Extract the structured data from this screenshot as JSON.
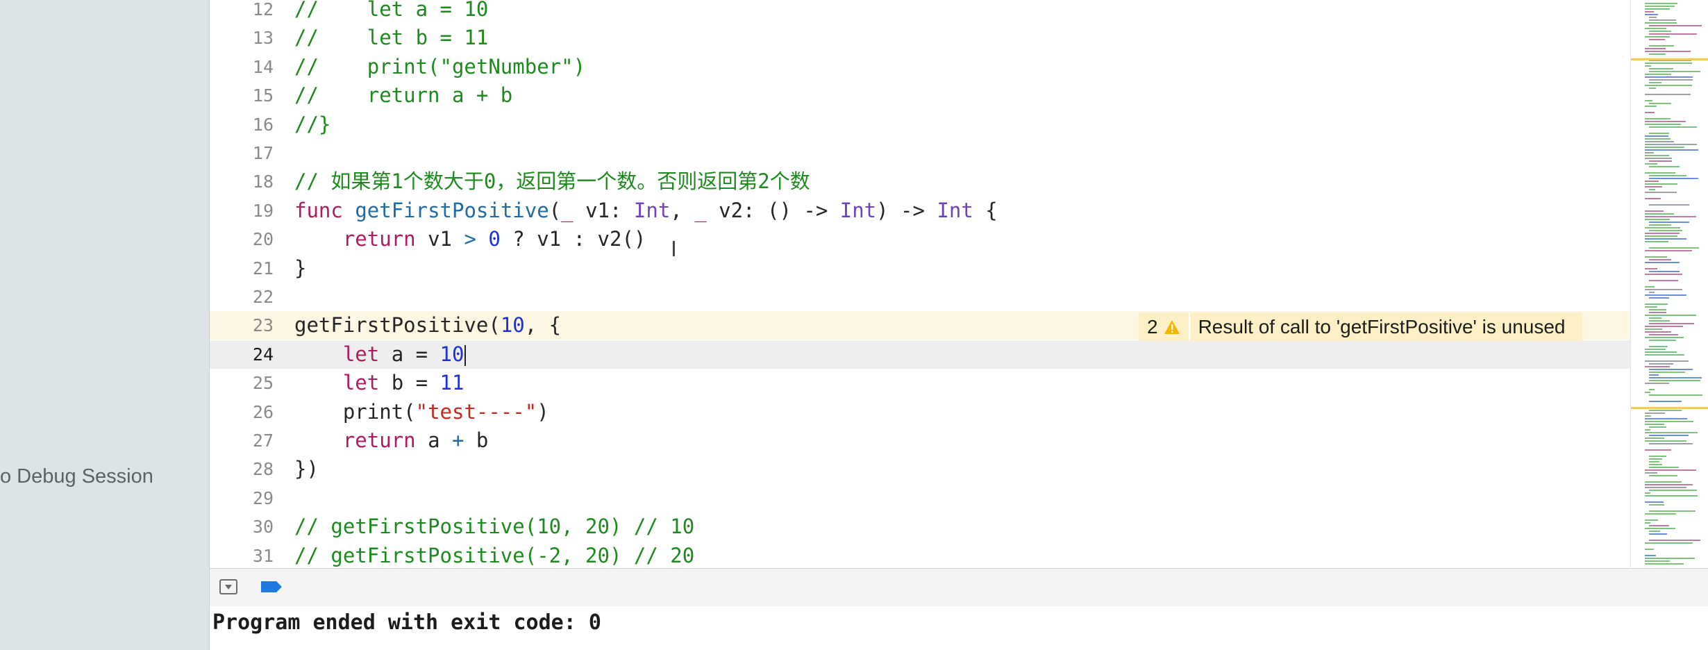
{
  "sidebar": {
    "debug_session_label": "o Debug Session"
  },
  "editor": {
    "lines": [
      {
        "num": "12",
        "tokens": [
          {
            "c": "c",
            "t": "//    let a = 10"
          }
        ]
      },
      {
        "num": "13",
        "tokens": [
          {
            "c": "c",
            "t": "//    let b = 11"
          }
        ]
      },
      {
        "num": "14",
        "tokens": [
          {
            "c": "c",
            "t": "//    print(\"getNumber\")"
          }
        ]
      },
      {
        "num": "15",
        "tokens": [
          {
            "c": "c",
            "t": "//    return a + b"
          }
        ]
      },
      {
        "num": "16",
        "tokens": [
          {
            "c": "c",
            "t": "//}"
          }
        ]
      },
      {
        "num": "17",
        "tokens": []
      },
      {
        "num": "18",
        "tokens": [
          {
            "c": "c",
            "t": "// 如果第1个数大于0，返回第一个数。否则返回第2个数"
          }
        ]
      },
      {
        "num": "19",
        "tokens": [
          {
            "c": "k",
            "t": "func "
          },
          {
            "c": "f",
            "t": "getFirstPositive"
          },
          {
            "c": "p",
            "t": "("
          },
          {
            "c": "k",
            "t": "_ "
          },
          {
            "c": "i",
            "t": "v1: "
          },
          {
            "c": "t",
            "t": "Int"
          },
          {
            "c": "p",
            "t": ", "
          },
          {
            "c": "k",
            "t": "_ "
          },
          {
            "c": "i",
            "t": "v2: () -> "
          },
          {
            "c": "t",
            "t": "Int"
          },
          {
            "c": "p",
            "t": ") -> "
          },
          {
            "c": "t",
            "t": "Int"
          },
          {
            "c": "p",
            "t": " {"
          }
        ]
      },
      {
        "num": "20",
        "tokens": [
          {
            "c": "p",
            "t": "    "
          },
          {
            "c": "k",
            "t": "return "
          },
          {
            "c": "i",
            "t": "v1 "
          },
          {
            "c": "f",
            "t": "> "
          },
          {
            "c": "n",
            "t": "0"
          },
          {
            "c": "p",
            "t": " ? v1 : v2()"
          }
        ]
      },
      {
        "num": "21",
        "tokens": [
          {
            "c": "p",
            "t": "}"
          }
        ]
      },
      {
        "num": "22",
        "tokens": []
      },
      {
        "num": "23",
        "highlight": "warning",
        "tokens": [
          {
            "c": "i",
            "t": "getFirstPositive("
          },
          {
            "c": "n",
            "t": "10"
          },
          {
            "c": "p",
            "t": ", {"
          }
        ]
      },
      {
        "num": "24",
        "highlight": "current",
        "cursor": true,
        "tokens": [
          {
            "c": "p",
            "t": "    "
          },
          {
            "c": "k",
            "t": "let "
          },
          {
            "c": "i",
            "t": "a = "
          },
          {
            "c": "n",
            "t": "10"
          }
        ]
      },
      {
        "num": "25",
        "tokens": [
          {
            "c": "p",
            "t": "    "
          },
          {
            "c": "k",
            "t": "let "
          },
          {
            "c": "i",
            "t": "b = "
          },
          {
            "c": "n",
            "t": "11"
          }
        ]
      },
      {
        "num": "26",
        "tokens": [
          {
            "c": "p",
            "t": "    "
          },
          {
            "c": "i",
            "t": "print("
          },
          {
            "c": "s",
            "t": "\"test----\""
          },
          {
            "c": "p",
            "t": ")"
          }
        ]
      },
      {
        "num": "27",
        "tokens": [
          {
            "c": "p",
            "t": "    "
          },
          {
            "c": "k",
            "t": "return "
          },
          {
            "c": "i",
            "t": "a "
          },
          {
            "c": "f",
            "t": "+"
          },
          {
            "c": "i",
            "t": " b"
          }
        ]
      },
      {
        "num": "28",
        "tokens": [
          {
            "c": "p",
            "t": "})"
          }
        ]
      },
      {
        "num": "29",
        "tokens": []
      },
      {
        "num": "30",
        "tokens": [
          {
            "c": "c",
            "t": "// getFirstPositive(10, 20) // 10"
          }
        ]
      },
      {
        "num": "31",
        "tokens": [
          {
            "c": "c",
            "t": "// getFirstPositive(-2, 20) // 20"
          }
        ]
      }
    ],
    "warning": {
      "count": "2",
      "icon": "warning-triangle-icon",
      "message": "Result of call to 'getFirstPositive' is unused"
    }
  },
  "console": {
    "hide_icon": "hide-console-icon",
    "breakpoint_icon": "breakpoint-icon",
    "output": "Program ended with exit code: 0"
  },
  "colors": {
    "keyword": "#b01b5f",
    "function": "#1d6ba8",
    "type": "#6f42c1",
    "number": "#1c32d6",
    "string": "#c4281f",
    "comment": "#1d8a1d",
    "warning_bg": "#fdf0c6",
    "breakpoint": "#1f7ae0"
  }
}
